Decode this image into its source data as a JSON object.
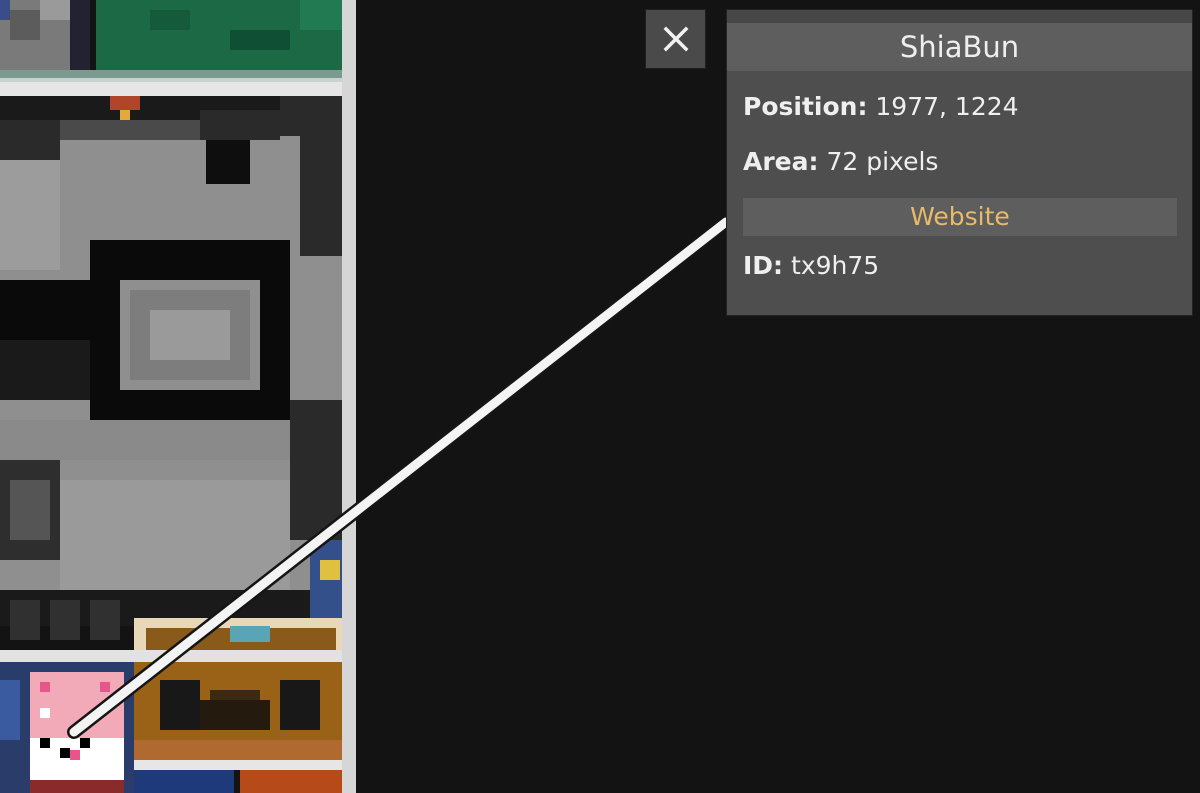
{
  "popup": {
    "title": "ShiaBun",
    "position_label": "Position:",
    "position_value": "1977, 1224",
    "area_label": "Area:",
    "area_value": "72 pixels",
    "website_label": "Website",
    "id_label": "ID:",
    "id_value": "tx9h75"
  },
  "icons": {
    "close": "close-icon"
  },
  "colors": {
    "background": "#131313",
    "panel": "#4e4e4e",
    "panel_header": "#5e5e5e",
    "link": "#e8ba6a",
    "close_button": "#4a4a4a",
    "pointer_line": "#f4f4f4"
  }
}
